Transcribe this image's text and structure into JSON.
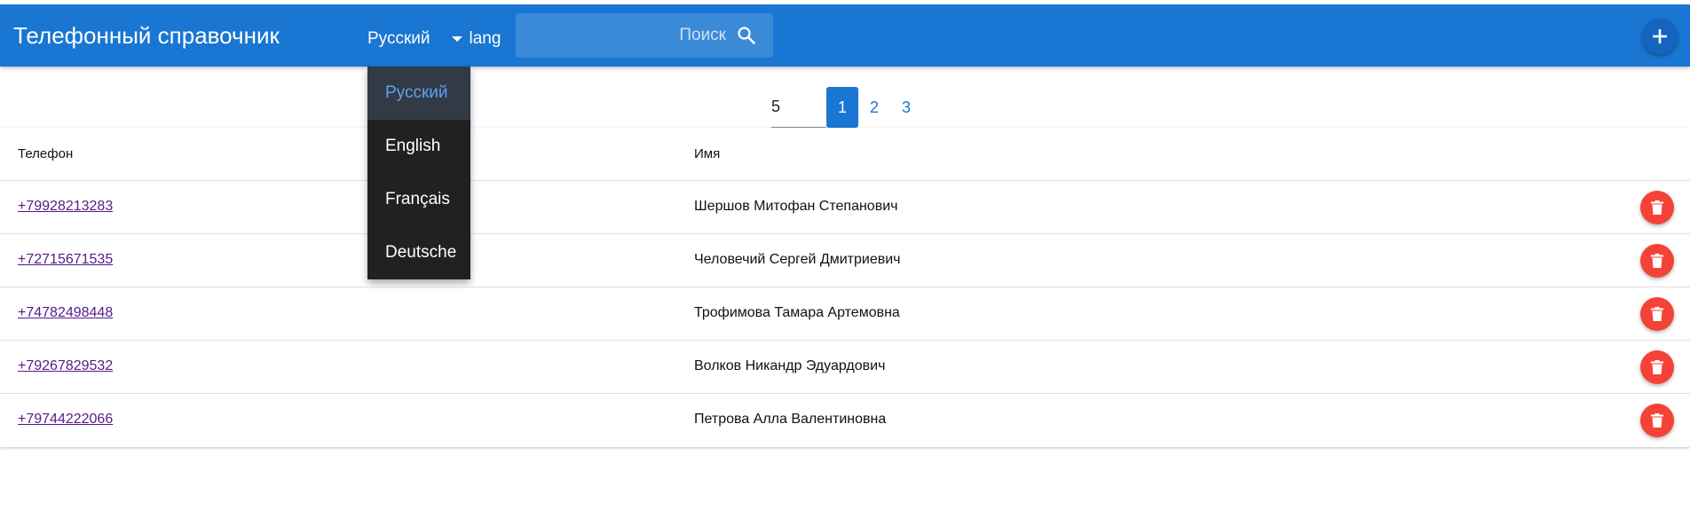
{
  "header": {
    "title": "Телефонный справочник",
    "language": {
      "selected": "Русский",
      "label": "lang",
      "options": [
        "Русский",
        "English",
        "Français",
        "Deutsche"
      ]
    },
    "search": {
      "placeholder": "Поиск"
    },
    "add_icon": "plus-icon"
  },
  "pagination": {
    "page_size": "5",
    "pages": [
      "1",
      "2",
      "3"
    ],
    "current_page": "1"
  },
  "table": {
    "columns": {
      "phone": "Телефон",
      "name": "Имя"
    },
    "rows": [
      {
        "phone": "+79928213283",
        "name": "Шершов Митофан Степанович"
      },
      {
        "phone": "+72715671535",
        "name": "Человечий Сергей Дмитриевич"
      },
      {
        "phone": "+74782498448",
        "name": "Трофимова Тамара Артемовна"
      },
      {
        "phone": "+79267829532",
        "name": "Волков Никандр Эдуардович"
      },
      {
        "phone": "+79744222066",
        "name": "Петрова Алла Валентиновна"
      }
    ],
    "delete_icon": "trash-icon"
  },
  "colors": {
    "appbar": "#1976d2",
    "menu_bg": "#212121",
    "menu_selected_text": "#5ea1f0",
    "delete": "#f44336",
    "link": "#551a8b"
  }
}
